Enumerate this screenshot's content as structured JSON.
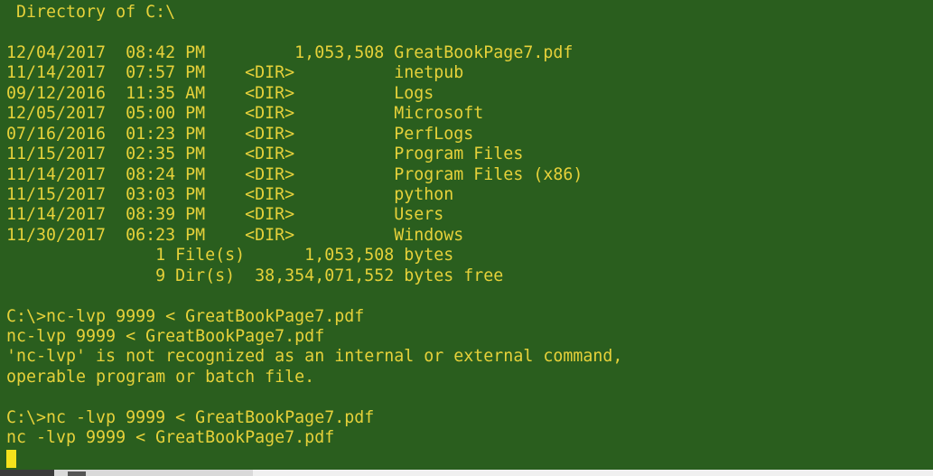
{
  "terminal": {
    "text_color": "#e6d13a",
    "background_color": "#2a5e1e",
    "lines": [
      " Directory of C:\\",
      "",
      "12/04/2017  08:42 PM         1,053,508 GreatBookPage7.pdf",
      "11/14/2017  07:57 PM    <DIR>          inetpub",
      "09/12/2016  11:35 AM    <DIR>          Logs",
      "12/05/2017  05:00 PM    <DIR>          Microsoft",
      "07/16/2016  01:23 PM    <DIR>          PerfLogs",
      "11/15/2017  02:35 PM    <DIR>          Program Files",
      "11/14/2017  08:24 PM    <DIR>          Program Files (x86)",
      "11/15/2017  03:03 PM    <DIR>          python",
      "11/14/2017  08:39 PM    <DIR>          Users",
      "11/30/2017  06:23 PM    <DIR>          Windows",
      "               1 File(s)      1,053,508 bytes",
      "               9 Dir(s)  38,354,071,552 bytes free",
      "",
      "C:\\>nc-lvp 9999 < GreatBookPage7.pdf",
      "nc-lvp 9999 < GreatBookPage7.pdf",
      "'nc-lvp' is not recognized as an internal or external command,",
      "operable program or batch file.",
      "",
      "C:\\>nc -lvp 9999 < GreatBookPage7.pdf",
      "nc -lvp 9999 < GreatBookPage7.pdf"
    ]
  }
}
